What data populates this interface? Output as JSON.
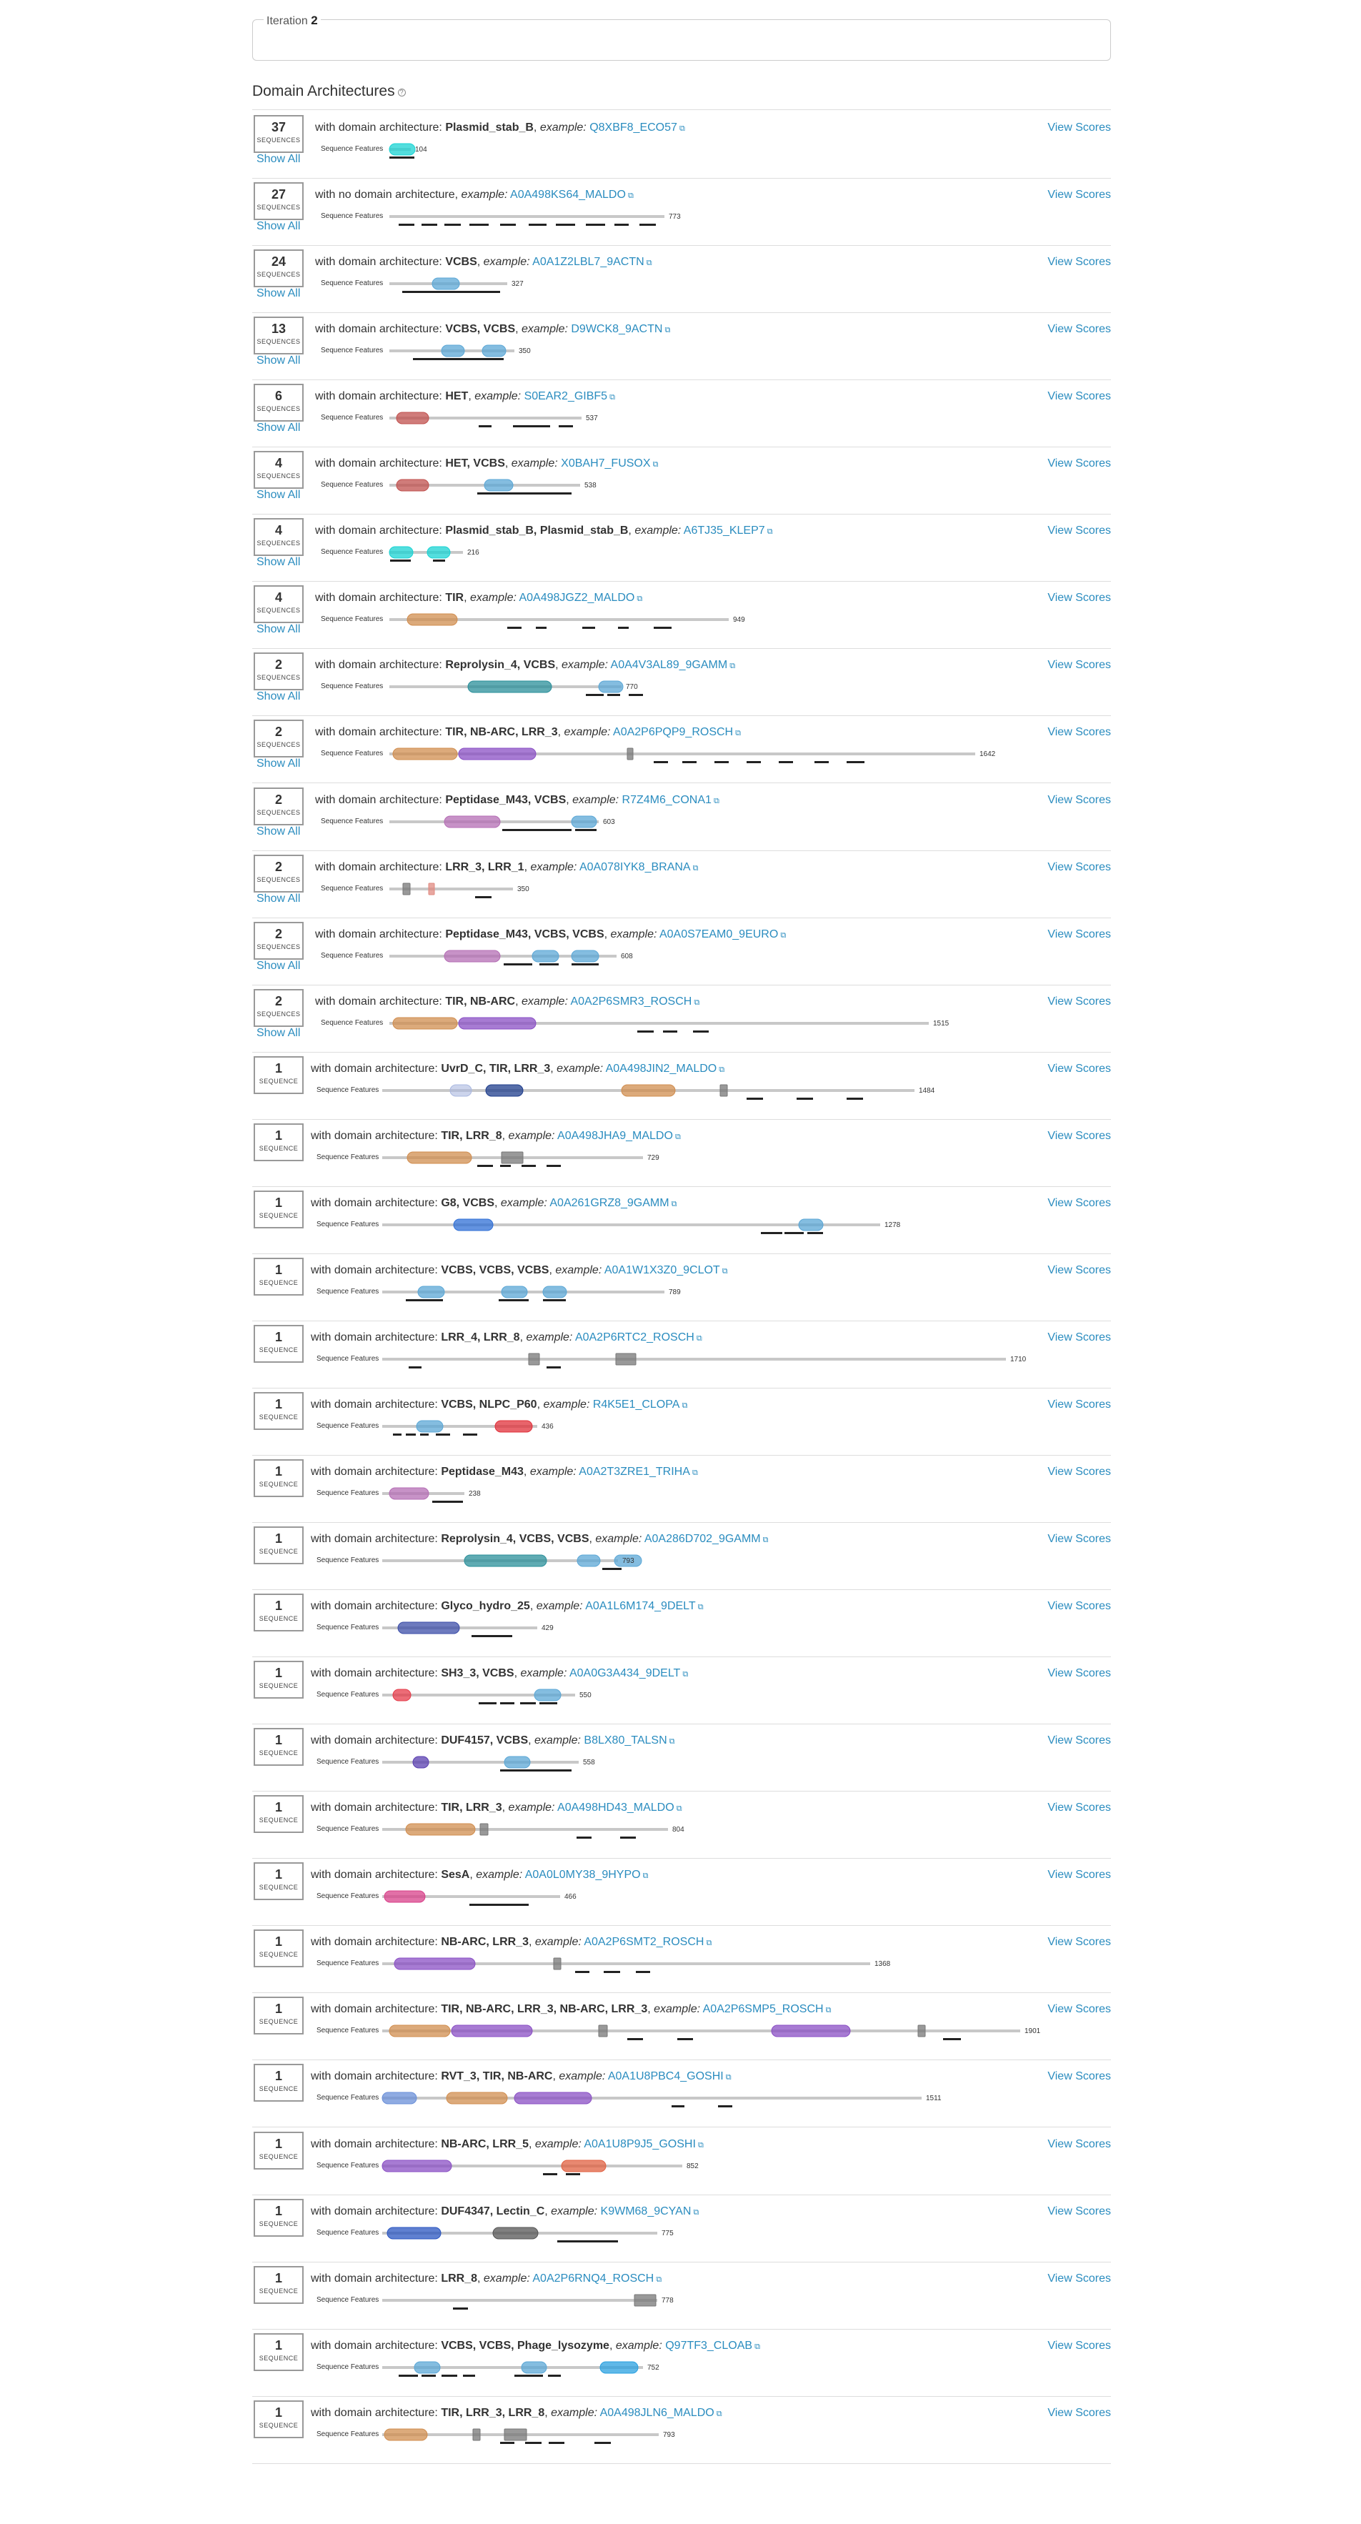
{
  "iteration": {
    "label": "Iteration",
    "value": "2"
  },
  "section_title": "Domain Architectures",
  "labels": {
    "with_arch": "with domain architecture:",
    "no_arch": "with no domain architecture",
    "example": "example:",
    "view_scores": "View Scores",
    "show_all": "Show All",
    "seq_features": "Sequence Features",
    "sequences": "SEQUENCES",
    "sequence": "SEQUENCE"
  },
  "colors": {
    "link": "#2a8cbf",
    "Plasmid_stab_B": "#1ad3d3",
    "VCBS": "#5ba7d6",
    "HET": "#c0504d",
    "TIR": "#d08d4f",
    "NB-ARC": "#8a4fc4",
    "LRR": "#777777",
    "Reprolysin_4": "#2a8f9a",
    "Peptidase_M43": "#b46db4",
    "G8": "#2f6fd6",
    "UvrD_C": "#1f3d8c",
    "NLPC_P60": "#e0303a",
    "Glyco_hydro_25": "#3c4ea8",
    "SH3_3": "#e53b4a",
    "DUF4157": "#5a3fb0",
    "SesA": "#d8408a",
    "RVT_3": "#6a8fd8",
    "LRR_5": "#e06040",
    "DUF4347": "#2a55c0",
    "Lectin_C": "#555555",
    "Phage_lysozyme": "#2aa0e0"
  },
  "rows": [
    {
      "count": "37",
      "plural": true,
      "arch": "Plasmid_stab_B",
      "example": "Q8XBF8_ECO57",
      "length": "104"
    },
    {
      "count": "27",
      "plural": true,
      "arch": "",
      "example": "A0A498KS64_MALDO",
      "length": "773"
    },
    {
      "count": "24",
      "plural": true,
      "arch": "VCBS",
      "example": "A0A1Z2LBL7_9ACTN",
      "length": "327"
    },
    {
      "count": "13",
      "plural": true,
      "arch": "VCBS, VCBS",
      "example": "D9WCK8_9ACTN",
      "length": "350"
    },
    {
      "count": "6",
      "plural": true,
      "arch": "HET",
      "example": "S0EAR2_GIBF5",
      "length": "537"
    },
    {
      "count": "4",
      "plural": true,
      "arch": "HET, VCBS",
      "example": "X0BAH7_FUSOX",
      "length": "538"
    },
    {
      "count": "4",
      "plural": true,
      "arch": "Plasmid_stab_B, Plasmid_stab_B",
      "example": "A6TJ35_KLEP7",
      "length": "216"
    },
    {
      "count": "4",
      "plural": true,
      "arch": "TIR",
      "example": "A0A498JGZ2_MALDO",
      "length": "949"
    },
    {
      "count": "2",
      "plural": true,
      "arch": "Reprolysin_4, VCBS",
      "example": "A0A4V3AL89_9GAMM",
      "length": "770"
    },
    {
      "count": "2",
      "plural": true,
      "arch": "TIR, NB-ARC, LRR_3",
      "example": "A0A2P6PQP9_ROSCH",
      "length": "1642"
    },
    {
      "count": "2",
      "plural": true,
      "arch": "Peptidase_M43, VCBS",
      "example": "R7Z4M6_CONA1",
      "length": "603"
    },
    {
      "count": "2",
      "plural": true,
      "arch": "LRR_3, LRR_1",
      "example": "A0A078IYK8_BRANA",
      "length": "350"
    },
    {
      "count": "2",
      "plural": true,
      "arch": "Peptidase_M43, VCBS, VCBS",
      "example": "A0A0S7EAM0_9EURO",
      "length": "608"
    },
    {
      "count": "2",
      "plural": true,
      "arch": "TIR, NB-ARC",
      "example": "A0A2P6SMR3_ROSCH",
      "length": "1515"
    },
    {
      "count": "1",
      "plural": false,
      "arch": "UvrD_C, TIR, LRR_3",
      "example": "A0A498JIN2_MALDO",
      "length": "1484"
    },
    {
      "count": "1",
      "plural": false,
      "arch": "TIR, LRR_8",
      "example": "A0A498JHA9_MALDO",
      "length": "729"
    },
    {
      "count": "1",
      "plural": false,
      "arch": "G8, VCBS",
      "example": "A0A261GRZ8_9GAMM",
      "length": "1278"
    },
    {
      "count": "1",
      "plural": false,
      "arch": "VCBS, VCBS, VCBS",
      "example": "A0A1W1X3Z0_9CLOT",
      "length": "789"
    },
    {
      "count": "1",
      "plural": false,
      "arch": "LRR_4, LRR_8",
      "example": "A0A2P6RTC2_ROSCH",
      "length": "1710"
    },
    {
      "count": "1",
      "plural": false,
      "arch": "VCBS, NLPC_P60",
      "example": "R4K5E1_CLOPA",
      "length": "436"
    },
    {
      "count": "1",
      "plural": false,
      "arch": "Peptidase_M43",
      "example": "A0A2T3ZRE1_TRIHA",
      "length": "238"
    },
    {
      "count": "1",
      "plural": false,
      "arch": "Reprolysin_4, VCBS, VCBS",
      "example": "A0A286D702_9GAMM",
      "length": "793"
    },
    {
      "count": "1",
      "plural": false,
      "arch": "Glyco_hydro_25",
      "example": "A0A1L6M174_9DELT",
      "length": "429"
    },
    {
      "count": "1",
      "plural": false,
      "arch": "SH3_3, VCBS",
      "example": "A0A0G3A434_9DELT",
      "length": "550"
    },
    {
      "count": "1",
      "plural": false,
      "arch": "DUF4157, VCBS",
      "example": "B8LX80_TALSN",
      "length": "558"
    },
    {
      "count": "1",
      "plural": false,
      "arch": "TIR, LRR_3",
      "example": "A0A498HD43_MALDO",
      "length": "804"
    },
    {
      "count": "1",
      "plural": false,
      "arch": "SesA",
      "example": "A0A0L0MY38_9HYPO",
      "length": "466"
    },
    {
      "count": "1",
      "plural": false,
      "arch": "NB-ARC, LRR_3",
      "example": "A0A2P6SMT2_ROSCH",
      "length": "1368"
    },
    {
      "count": "1",
      "plural": false,
      "arch": "TIR, NB-ARC, LRR_3, NB-ARC, LRR_3",
      "example": "A0A2P6SMP5_ROSCH",
      "length": "1901"
    },
    {
      "count": "1",
      "plural": false,
      "arch": "RVT_3, TIR, NB-ARC",
      "example": "A0A1U8PBC4_GOSHI",
      "length": "1511"
    },
    {
      "count": "1",
      "plural": false,
      "arch": "NB-ARC, LRR_5",
      "example": "A0A1U8P9J5_GOSHI",
      "length": "852"
    },
    {
      "count": "1",
      "plural": false,
      "arch": "DUF4347, Lectin_C",
      "example": "K9WM68_9CYAN",
      "length": "775"
    },
    {
      "count": "1",
      "plural": false,
      "arch": "LRR_8",
      "example": "A0A2P6RNQ4_ROSCH",
      "length": "778"
    },
    {
      "count": "1",
      "plural": false,
      "arch": "VCBS, VCBS, Phage_lysozyme",
      "example": "Q97TF3_CLOAB",
      "length": "752"
    },
    {
      "count": "1",
      "plural": false,
      "arch": "TIR, LRR_3, LRR_8",
      "example": "A0A498JLN6_MALDO",
      "length": "793"
    }
  ]
}
